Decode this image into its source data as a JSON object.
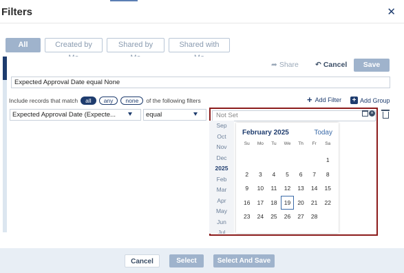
{
  "header": {
    "title": "Filters",
    "close_icon": "close-icon"
  },
  "tabs": [
    {
      "label": "All",
      "active": true
    },
    {
      "label": "Created by Me",
      "active": false
    },
    {
      "label": "Shared by Me",
      "active": false
    },
    {
      "label": "Shared with Me",
      "active": false
    }
  ],
  "actions": {
    "share_label": "Share",
    "cancel_label": "Cancel",
    "save_label": "Save"
  },
  "expression": "Expected Approval Date equal None",
  "match": {
    "prefix": "Include records that match",
    "options": [
      "all",
      "any",
      "none"
    ],
    "selected": "all",
    "suffix": "of the following filters"
  },
  "add_filter_label": "Add Filter",
  "add_group_label": "Add Group",
  "filter_row": {
    "field": "Expected Approval Date (Expecte...",
    "operator": "equal",
    "value_placeholder": "Not Set"
  },
  "month_list": [
    "Sep",
    "Oct",
    "Nov",
    "Dec",
    "2025",
    "Feb",
    "Mar",
    "Apr",
    "May",
    "Jun",
    "Jul"
  ],
  "calendar": {
    "title": "February 2025",
    "today_label": "Today",
    "weekdays": [
      "Su",
      "Mo",
      "Tu",
      "We",
      "Th",
      "Fr",
      "Sa"
    ],
    "days": [
      "",
      "",
      "",
      "",
      "",
      "",
      "1",
      "2",
      "3",
      "4",
      "5",
      "6",
      "7",
      "8",
      "9",
      "10",
      "11",
      "12",
      "13",
      "14",
      "15",
      "16",
      "17",
      "18",
      "19",
      "20",
      "21",
      "22",
      "23",
      "24",
      "25",
      "26",
      "27",
      "28",
      ""
    ],
    "selected_day": "19"
  },
  "footer": {
    "cancel_label": "Cancel",
    "select_label": "Select",
    "select_and_save_label": "Select And Save"
  },
  "colors": {
    "brand": "#1e3c6e",
    "accent": "#9fb3cc",
    "highlight_border": "#8b1a1a"
  }
}
